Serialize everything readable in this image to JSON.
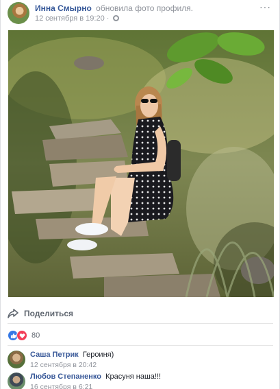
{
  "post": {
    "author": "Инна Смырно",
    "action": "обновила фото профиля.",
    "timestamp": "12 сентября в 19:20",
    "separator": "·",
    "privacy_icon": "globe-icon",
    "more_label": "···"
  },
  "actions": {
    "share_label": "Поделиться"
  },
  "reactions": {
    "types": [
      "like",
      "love"
    ],
    "count": "80",
    "like_color": "#3578e5",
    "love_color": "#f33e58"
  },
  "comments": [
    {
      "author": "Саша Петрик",
      "text": "Героиня)",
      "time": "12 сентября в 20:42"
    },
    {
      "author": "Любов Степаненко",
      "text": "Красуня наша!!!",
      "time": "16 сентября в 6:21"
    }
  ],
  "colors": {
    "link": "#365899",
    "meta": "#90949c"
  }
}
